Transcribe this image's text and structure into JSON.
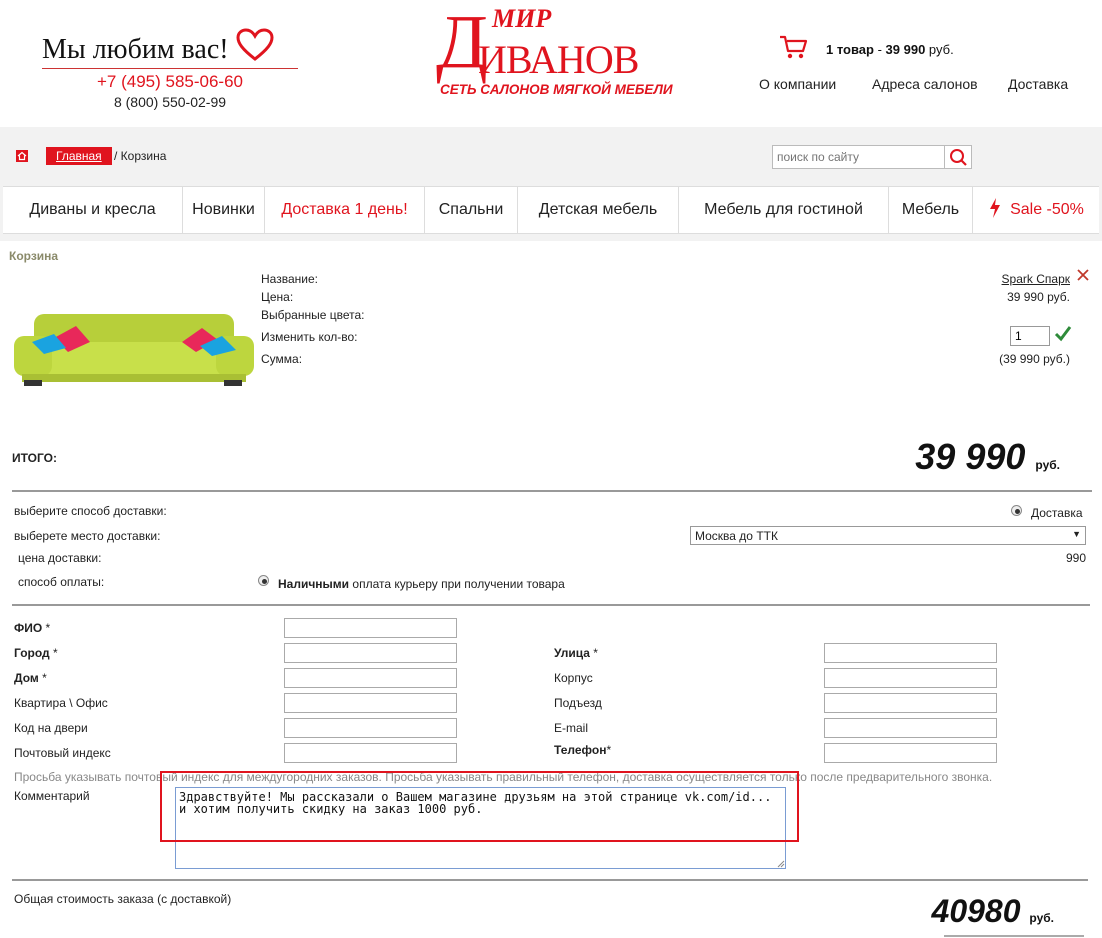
{
  "header": {
    "love_text": "Мы любим вас!",
    "phone_main": "+7 (495) 585-06-60",
    "phone_free": "8 (800) 550-02-99",
    "logo": {
      "mir": "МИР",
      "d": "Д",
      "ivanov": "ИВАНОВ",
      "tagline": "СЕТЬ САЛОНОВ МЯГКОЙ МЕБЕЛИ"
    },
    "cart_count": "1 товар",
    "cart_sep": " - ",
    "cart_sum": "39 990",
    "cart_currency": " руб.",
    "nav": [
      "О компании",
      "Адреса салонов",
      "Доставка"
    ]
  },
  "breadcrumb": {
    "home_label": "Главная",
    "current": "/ Корзина"
  },
  "search": {
    "placeholder": "поиск по сайту"
  },
  "menu": [
    "Диваны и кресла",
    "Новинки",
    "Доставка 1 день!",
    "Спальни",
    "Детская мебель",
    "Мебель для гостиной",
    "Мебель",
    "Sale -50%"
  ],
  "cart": {
    "title": "Корзина",
    "labels": {
      "name": "Название:",
      "price": "Цена:",
      "colors": "Выбранные цвета:",
      "qty": "Изменить кол-во:",
      "sum": "Сумма:"
    },
    "item": {
      "name": "Spark Спарк",
      "price": "39 990 руб.",
      "qty": "1",
      "sum": "(39 990 руб.)"
    },
    "total_label": "ИТОГО:",
    "total_value": "39 990",
    "currency": "руб."
  },
  "delivery": {
    "method_label": "выберите способ доставки:",
    "method_option": "Доставка",
    "place_label": "выберете место доставки:",
    "place_value": "Москва до ТТК",
    "price_label": "цена доставки:",
    "price_value": "990",
    "payment_label": "способ оплаты:",
    "payment_bold": "Наличными",
    "payment_rest": " оплата курьеру при получении товара"
  },
  "form": {
    "left": [
      {
        "label": "ФИО",
        "req": " *",
        "bold": true
      },
      {
        "label": "Город",
        "req": " *",
        "bold": true
      },
      {
        "label": "Дом",
        "req": " *",
        "bold": true
      },
      {
        "label": "Квартира \\ Офис",
        "req": "",
        "bold": false
      },
      {
        "label": "Код на двери",
        "req": "",
        "bold": false
      },
      {
        "label": "Почтовый индекс",
        "req": "",
        "bold": false
      }
    ],
    "right": [
      {
        "label": "Улица",
        "req": " *",
        "bold": true
      },
      {
        "label": "Корпус",
        "req": "",
        "bold": false
      },
      {
        "label": "Подъезд",
        "req": "",
        "bold": false
      },
      {
        "label": "E-mail",
        "req": "",
        "bold": false
      },
      {
        "label": "Телефон",
        "req": "*",
        "bold": true
      }
    ],
    "note": "Просьба указывать почтовый индекс для междугородних заказов. Просьба указывать правильный телефон, доставка осуществляется только после предварительного звонка.",
    "comment_label": "Комментарий",
    "comment_value": "Здравствуйте! Мы рассказали о Вашем магазине друзьям на этой странице vk.com/id... и хотим получить скидку на заказ 1000 руб."
  },
  "order": {
    "label": "Общая стоимость заказа (с доставкой)",
    "value": "40980",
    "currency": "руб."
  },
  "colors": {
    "brand_red": "#e0141e",
    "sofa_green": "#c8e04a"
  }
}
